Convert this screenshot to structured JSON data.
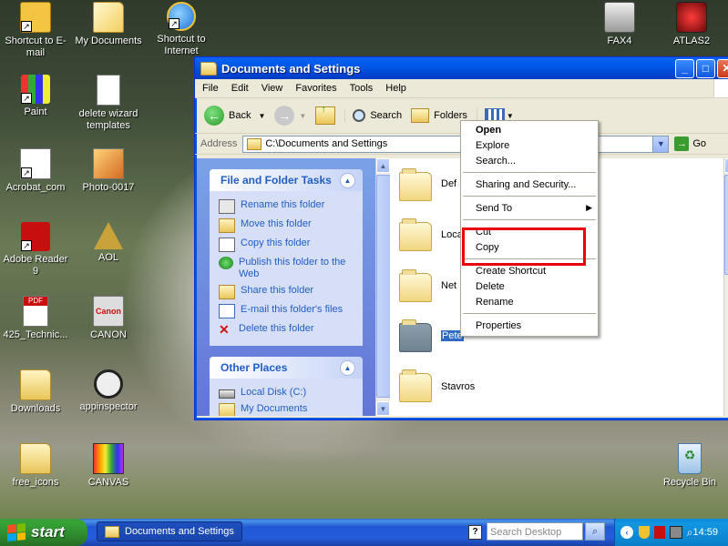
{
  "desktop": {
    "icons": [
      {
        "label": "Shortcut to E-mail"
      },
      {
        "label": "My Documents"
      },
      {
        "label": "Shortcut to Internet"
      },
      {
        "label": "FAX4"
      },
      {
        "label": "ATLAS2"
      },
      {
        "label": "Paint"
      },
      {
        "label": "delete wizard templates"
      },
      {
        "label": "Acrobat_com"
      },
      {
        "label": "Photo-0017"
      },
      {
        "label": "Adobe Reader 9"
      },
      {
        "label": "AOL"
      },
      {
        "label": "425_Technic..."
      },
      {
        "label": "CANON"
      },
      {
        "label": "Downloads"
      },
      {
        "label": "appinspector"
      },
      {
        "label": "free_icons"
      },
      {
        "label": "CANVAS"
      },
      {
        "label": "Recycle Bin"
      }
    ]
  },
  "window": {
    "title": "Documents and Settings",
    "menu": [
      "File",
      "Edit",
      "View",
      "Favorites",
      "Tools",
      "Help"
    ],
    "toolbar": {
      "back": "Back",
      "search": "Search",
      "folders": "Folders"
    },
    "address": {
      "label": "Address",
      "value": "C:\\Documents and Settings",
      "go": "Go"
    },
    "tasks_panel": {
      "title": "File and Folder Tasks",
      "items": [
        "Rename this folder",
        "Move this folder",
        "Copy this folder",
        "Publish this folder to the Web",
        "Share this folder",
        "E-mail this folder's files",
        "Delete this folder"
      ]
    },
    "places_panel": {
      "title": "Other Places",
      "items": [
        "Local Disk (C:)",
        "My Documents"
      ]
    },
    "folders": [
      "Def",
      "Loca",
      "Net",
      "Pete",
      "Stavros"
    ]
  },
  "context_menu": {
    "items": [
      "Open",
      "Explore",
      "Search...",
      "Sharing and Security...",
      "Send To",
      "Cut",
      "Copy",
      "Create Shortcut",
      "Delete",
      "Rename",
      "Properties"
    ]
  },
  "taskbar": {
    "start": "start",
    "active_task": "Documents and Settings",
    "search_placeholder": "Search Desktop",
    "clock": "14:59"
  }
}
